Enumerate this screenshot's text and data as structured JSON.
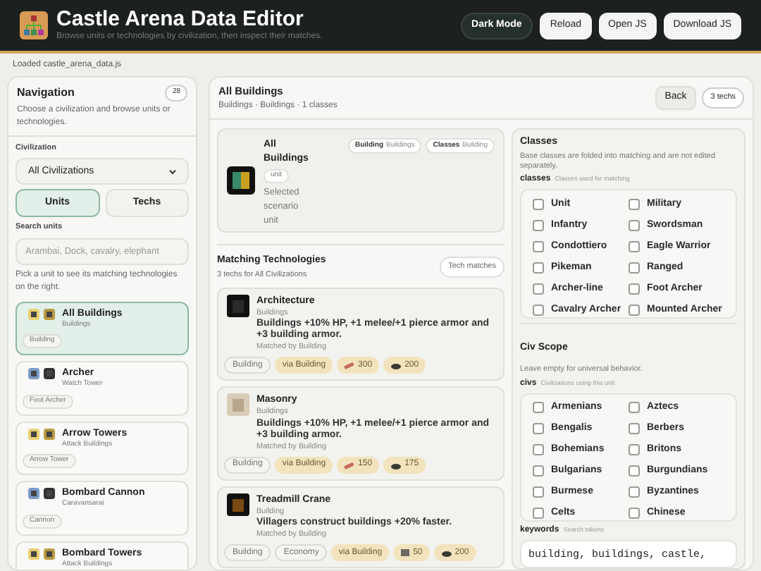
{
  "header": {
    "title": "Castle Arena Data Editor",
    "subtitle": "Browse units or technologies by civilization, then inspect their matches.",
    "buttons": [
      {
        "label": "Dark Mode",
        "kind": "dark"
      },
      {
        "label": "Reload",
        "kind": "light"
      },
      {
        "label": "Open JS",
        "kind": "light"
      },
      {
        "label": "Download JS",
        "kind": "light"
      }
    ]
  },
  "status": "Loaded castle_arena_data.js",
  "navigation": {
    "title": "Navigation",
    "count": "28",
    "description": "Choose a civilization and browse units or technologies.",
    "civ_label": "Civilization",
    "civ_value": "All Civilizations",
    "modes": [
      {
        "label": "Units",
        "selected": true
      },
      {
        "label": "Techs",
        "selected": false
      }
    ],
    "search_label": "Search units",
    "search_placeholder": "Arambai, Dock, cavalry, elephant",
    "hint": "Pick a unit to see its matching technologies on the right.",
    "units": [
      {
        "name": "All Buildings",
        "sub": "Buildings",
        "tag": "Building",
        "selected": true
      },
      {
        "name": "Archer",
        "sub": "Watch Tower",
        "tag": "Foot Archer",
        "selected": false
      },
      {
        "name": "Arrow Towers",
        "sub": "Attack Buildings",
        "tag": "Arrow Tower",
        "selected": false
      },
      {
        "name": "Bombard Cannon",
        "sub": "Caravansarai",
        "tag": "Cannon",
        "selected": false
      },
      {
        "name": "Bombard Towers",
        "sub": "Attack Buildings",
        "selected": false
      }
    ]
  },
  "detail": {
    "title": "All Buildings",
    "subtitle": "Buildings · Buildings · 1 classes",
    "back": "Back",
    "count": "3 techs",
    "selected": {
      "name": "All Buildings",
      "tag": "unit",
      "caption": "Selected scenario unit",
      "chips": [
        {
          "key": "Building",
          "value": "Buildings"
        },
        {
          "key": "Classes",
          "value": "Building"
        }
      ]
    },
    "matches_title": "Matching Technologies",
    "matches_sub": "3 techs for All Civilizations",
    "matches_badge": "Tech matches",
    "techs": [
      {
        "name": "Architecture",
        "category": "Buildings",
        "description": "Buildings +10% HP, +1 melee/+1 pierce armor and +3 building armor.",
        "matched": "Matched by Building",
        "tags": [
          {
            "label": "Building",
            "kind": "plain"
          },
          {
            "label": "via Building",
            "kind": "via"
          },
          {
            "label": "300",
            "kind": "wood"
          },
          {
            "label": "200",
            "kind": "gold"
          }
        ]
      },
      {
        "name": "Masonry",
        "category": "Buildings",
        "description": "Buildings +10% HP, +1 melee/+1 pierce armor and +3 building armor.",
        "matched": "Matched by Building",
        "tags": [
          {
            "label": "Building",
            "kind": "plain"
          },
          {
            "label": "via Building",
            "kind": "via"
          },
          {
            "label": "150",
            "kind": "wood"
          },
          {
            "label": "175",
            "kind": "gold"
          }
        ]
      },
      {
        "name": "Treadmill Crane",
        "category": "Building",
        "description": "Villagers construct buildings +20% faster.",
        "matched": "Matched by Building",
        "tags": [
          {
            "label": "Building",
            "kind": "plain"
          },
          {
            "label": "Economy",
            "kind": "plain"
          },
          {
            "label": "via Building",
            "kind": "via"
          },
          {
            "label": "50",
            "kind": "stone"
          },
          {
            "label": "200",
            "kind": "gold"
          }
        ]
      }
    ]
  },
  "classes": {
    "title": "Classes",
    "description": "Base classes are folded into matching and are not edited separately.",
    "field": "classes",
    "field_hint": "Classes used for matching",
    "options": [
      {
        "label": "Unit",
        "checked": false
      },
      {
        "label": "Military",
        "checked": false
      },
      {
        "label": "Infantry",
        "checked": false
      },
      {
        "label": "Swordsman",
        "checked": false
      },
      {
        "label": "Condottiero",
        "checked": false
      },
      {
        "label": "Eagle Warrior",
        "checked": false
      },
      {
        "label": "Pikeman",
        "checked": false
      },
      {
        "label": "Ranged",
        "checked": false
      },
      {
        "label": "Archer-line",
        "checked": false
      },
      {
        "label": "Foot Archer",
        "checked": false
      },
      {
        "label": "Cavalry Archer",
        "checked": false
      },
      {
        "label": "Mounted Archer",
        "checked": false
      }
    ]
  },
  "civ_scope": {
    "title": "Civ Scope",
    "description": "Leave empty for universal behavior.",
    "field": "civs",
    "field_hint": "Civilizations using this unit",
    "options": [
      {
        "label": "Armenians",
        "checked": false
      },
      {
        "label": "Aztecs",
        "checked": false
      },
      {
        "label": "Bengalis",
        "checked": false
      },
      {
        "label": "Berbers",
        "checked": false
      },
      {
        "label": "Bohemians",
        "checked": false
      },
      {
        "label": "Britons",
        "checked": false
      },
      {
        "label": "Bulgarians",
        "checked": false
      },
      {
        "label": "Burgundians",
        "checked": false
      },
      {
        "label": "Burmese",
        "checked": false
      },
      {
        "label": "Byzantines",
        "checked": false
      },
      {
        "label": "Celts",
        "checked": false
      },
      {
        "label": "Chinese",
        "checked": false
      }
    ]
  },
  "keywords": {
    "field": "keywords",
    "field_hint": "Search tokens",
    "value": "building, buildings, castle,"
  }
}
